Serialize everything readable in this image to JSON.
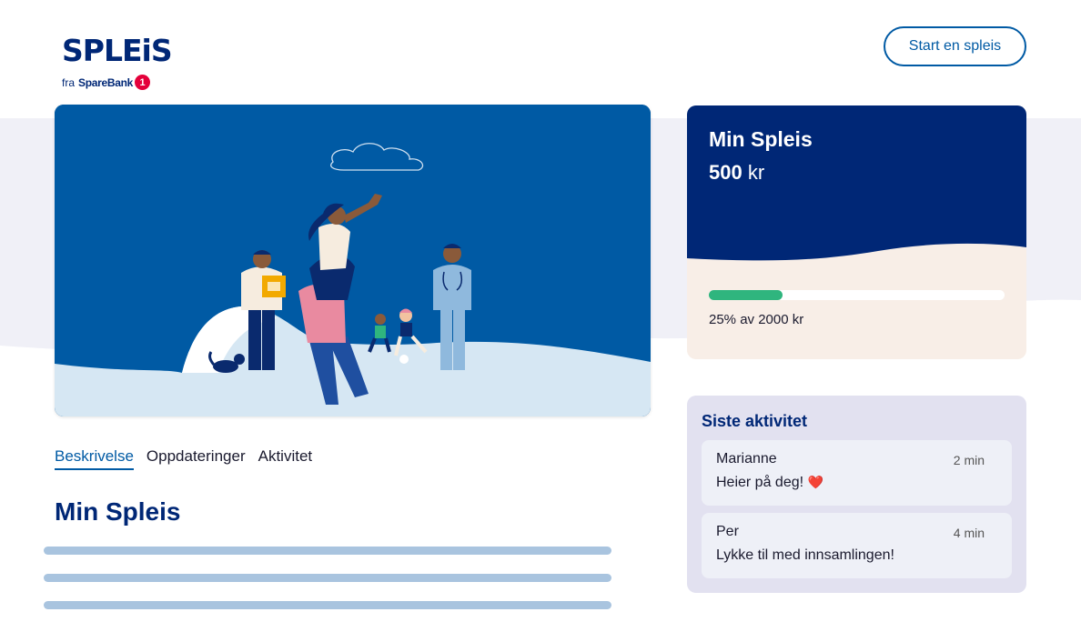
{
  "brand": {
    "logo_text": "SPLEiS",
    "sub_prefix": "fra",
    "sub_bank": "SpareBank",
    "sub_number": "1",
    "color_primary": "#002776",
    "color_accent": "#005aa4",
    "color_badge": "#e4003a"
  },
  "header": {
    "start_label": "Start en spleis"
  },
  "tabs": [
    {
      "label": "Beskrivelse",
      "active": true
    },
    {
      "label": "Oppdateringer",
      "active": false
    },
    {
      "label": "Aktivitet",
      "active": false
    }
  ],
  "main": {
    "title": "Min Spleis"
  },
  "summary": {
    "name": "Min Spleis",
    "amount": "500",
    "currency": "kr",
    "progress_percent": 25,
    "progress_text": "25% av 2000 kr",
    "progress_color": "#2fb57e"
  },
  "activity": {
    "title": "Siste aktivitet",
    "items": [
      {
        "name": "Marianne",
        "time": "2 min",
        "message": "Heier på deg!",
        "emoji": "❤️"
      },
      {
        "name": "Per",
        "time": "4 min",
        "message": "Lykke til med innsamlingen!",
        "emoji": ""
      }
    ]
  },
  "icons": {
    "logo_badge": "sparebank-one-icon",
    "heart": "heart-icon"
  }
}
